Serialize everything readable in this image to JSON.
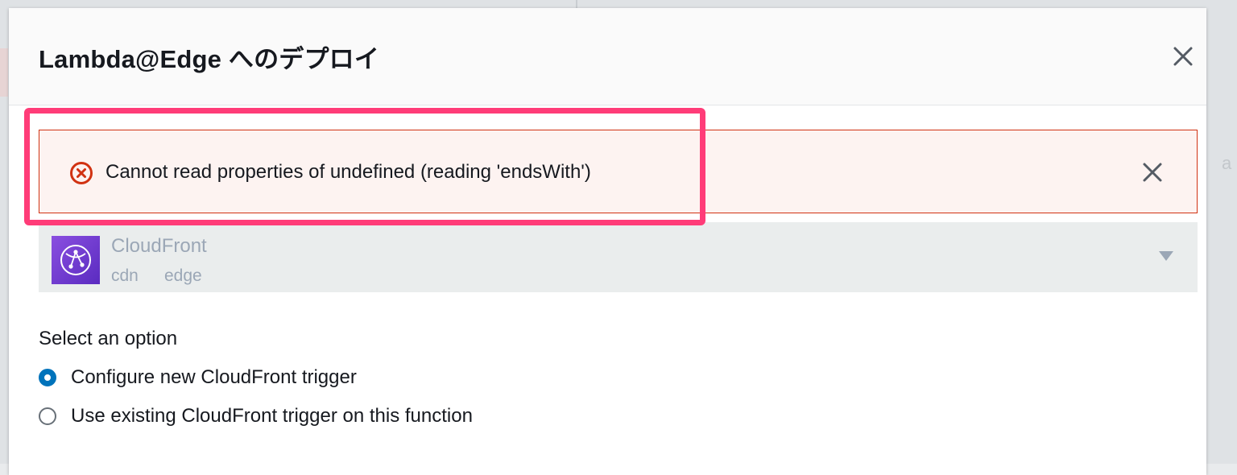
{
  "modal": {
    "title": "Lambda@Edge へのデプロイ"
  },
  "alert": {
    "message": "Cannot read properties of undefined (reading 'endsWith')",
    "icon": "error-circle-icon",
    "color": "#d13212"
  },
  "service_select": {
    "name": "CloudFront",
    "tags": [
      "cdn",
      "edge"
    ],
    "logo_color": "#6b3fd4"
  },
  "options": {
    "label": "Select an option",
    "items": [
      {
        "label": "Configure new CloudFront trigger",
        "selected": true
      },
      {
        "label": "Use existing CloudFront trigger on this function",
        "selected": false
      }
    ]
  },
  "backdrop": {
    "edge_text": "a"
  },
  "colors": {
    "accent": "#0073bb",
    "highlight": "#ff3c78"
  }
}
